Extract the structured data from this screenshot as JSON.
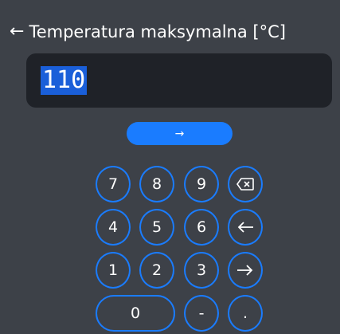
{
  "header": {
    "back_icon": "arrow-left-icon",
    "title": "Temperatura maksymalna [°C]"
  },
  "input": {
    "value": "110"
  },
  "enter": {
    "icon": "arrow-right-icon",
    "glyph": "→"
  },
  "keypad": {
    "k7": "7",
    "k8": "8",
    "k9": "9",
    "k4": "4",
    "k5": "5",
    "k6": "6",
    "k1": "1",
    "k2": "2",
    "k3": "3",
    "k0": "0",
    "kminus": "-",
    "kdot": ".",
    "backspace_icon": "backspace-icon",
    "left_icon": "arrow-left-icon",
    "right_icon": "arrow-right-icon"
  },
  "colors": {
    "background": "#3d4148",
    "field": "#1f2228",
    "accent": "#1a7cff",
    "selection": "#1a5fd9"
  }
}
